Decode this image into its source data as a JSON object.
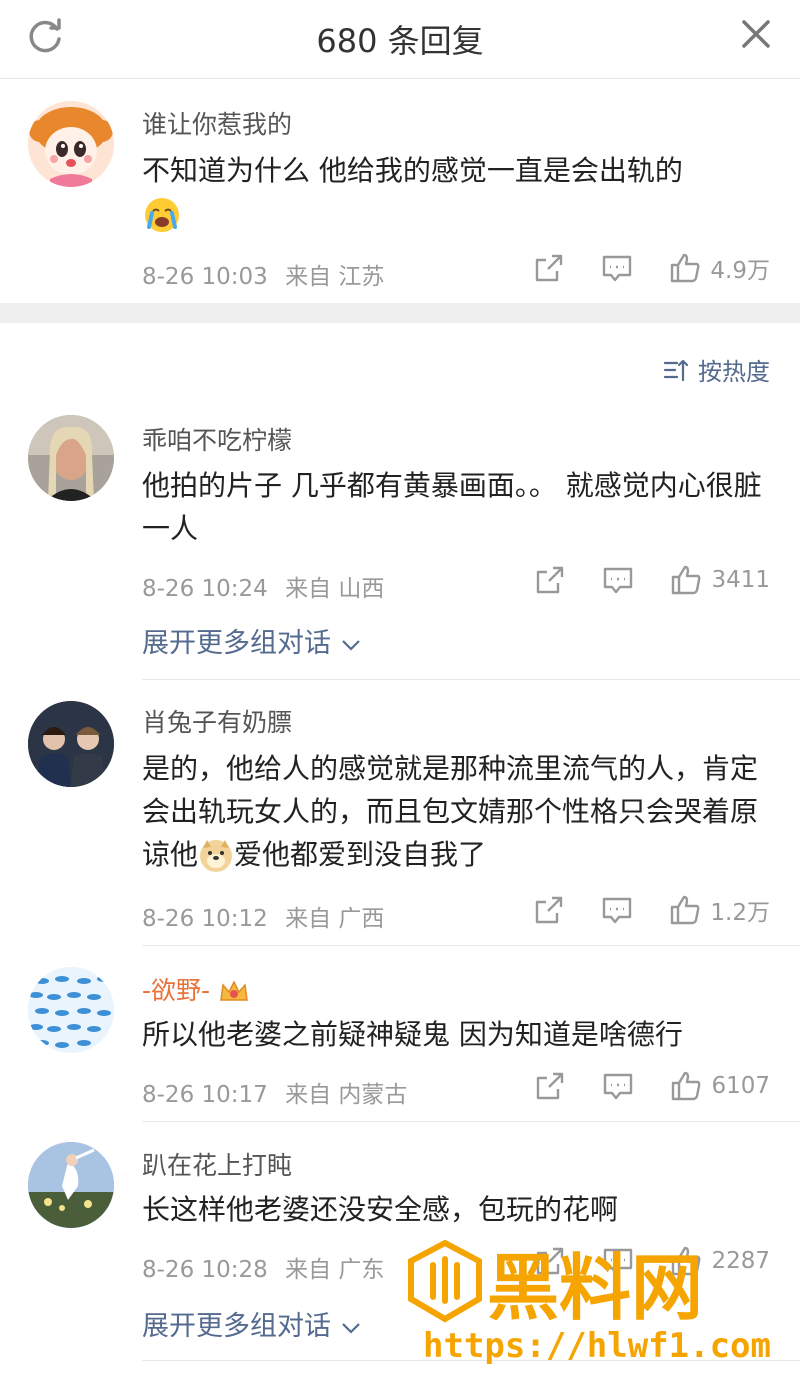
{
  "header": {
    "title": "680 条回复"
  },
  "top_comment": {
    "username": "谁让你惹我的",
    "text": "不知道为什么 他给我的感觉一直是会出轨的",
    "time": "8-26 10:03",
    "from_label": "来自",
    "location": "江苏",
    "likes": "4.9万"
  },
  "sort": {
    "label": "按热度"
  },
  "comments": [
    {
      "username": "乖咱不吃柠檬",
      "text": "他拍的片子 几乎都有黄暴画面。。 就感觉内心很脏一人",
      "time": "8-26 10:24",
      "from_label": "来自",
      "location": "山西",
      "likes": "3411",
      "expand": "展开更多组对话"
    },
    {
      "username": "肖兔子有奶膘",
      "text_a": "是的，他给人的感觉就是那种流里流气的人，肯定会出轨玩女人的，而且包文婧那个性格只会哭着原谅他",
      "text_b": "爱他都爱到没自我了",
      "time": "8-26 10:12",
      "from_label": "来自",
      "location": "广西",
      "likes": "1.2万"
    },
    {
      "username": "-欲野-",
      "text": "所以他老婆之前疑神疑鬼 因为知道是啥德行",
      "time": "8-26 10:17",
      "from_label": "来自",
      "location": "内蒙古",
      "likes": "6107"
    },
    {
      "username": "趴在花上打盹",
      "text": "长这样他老婆还没安全感，包玩的花啊",
      "time": "8-26 10:28",
      "from_label": "来自",
      "location": "广东",
      "likes": "2287",
      "expand": "展开更多组对话"
    }
  ],
  "watermark": {
    "brand": "黑料网",
    "url": "https://hlwf1.com"
  },
  "colors": {
    "link": "#546b8f",
    "meta": "#999999",
    "accent": "#e8733a",
    "watermark": "#f5a400"
  }
}
